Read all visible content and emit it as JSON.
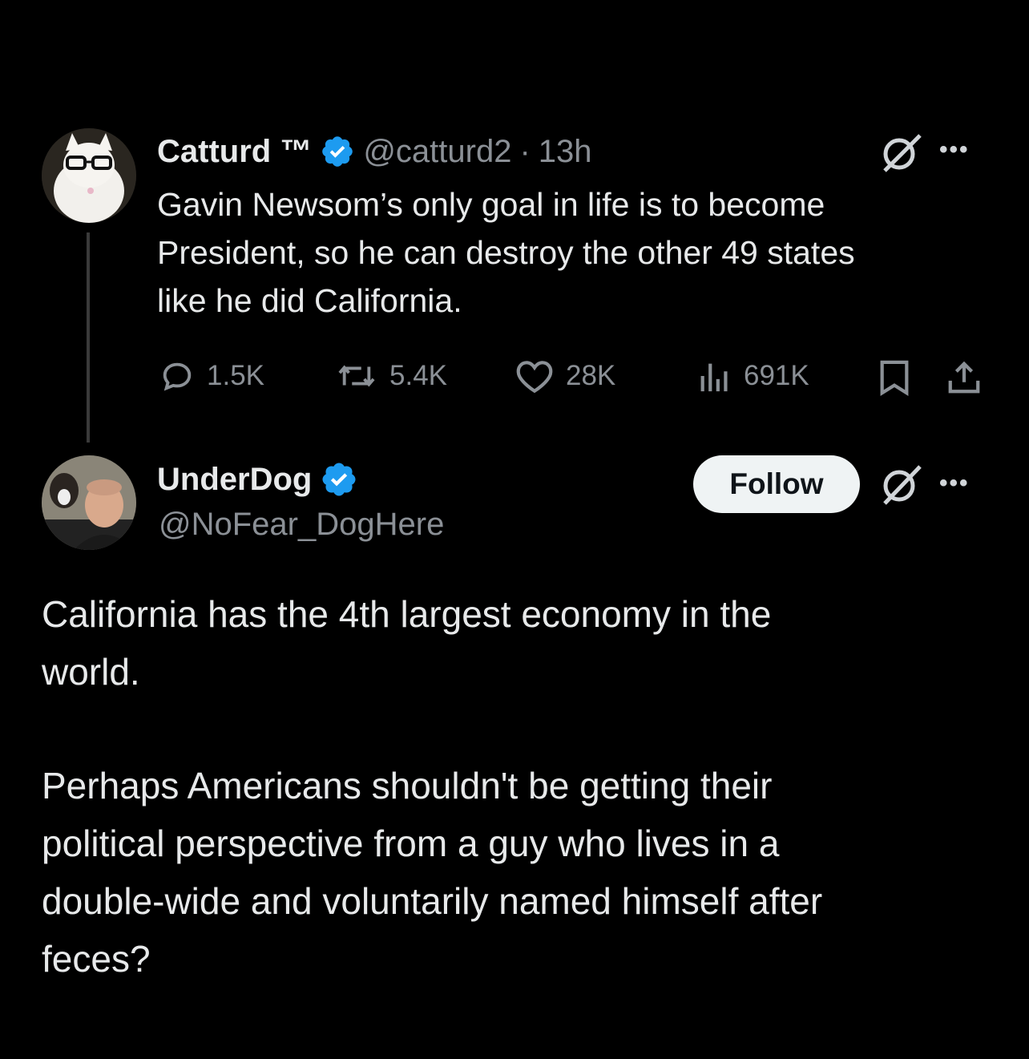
{
  "original_tweet": {
    "display_name": "Catturd ™",
    "handle": "@catturd2",
    "separator": "·",
    "time_ago": "13h",
    "text_lines": [
      "Gavin Newsom’s only goal in life is to become",
      "President, so he can destroy the other 49 states",
      "like he did California."
    ],
    "stats": {
      "replies": "1.5K",
      "reposts": "5.4K",
      "likes": "28K",
      "views": "691K"
    }
  },
  "reply_tweet": {
    "display_name": "UnderDog",
    "handle": "@NoFear_DogHere",
    "follow_label": "Follow",
    "paragraph_1_lines": [
      "California has the 4th largest economy in the",
      "world."
    ],
    "paragraph_2_lines": [
      "Perhaps Americans shouldn't be getting their",
      "political perspective from a guy who lives in a",
      "double-wide and voluntarily named himself after",
      "feces?"
    ]
  },
  "colors": {
    "background": "#000000",
    "text": "#e7e9ea",
    "muted": "#8b9096",
    "verified": "#1d9bf0"
  }
}
